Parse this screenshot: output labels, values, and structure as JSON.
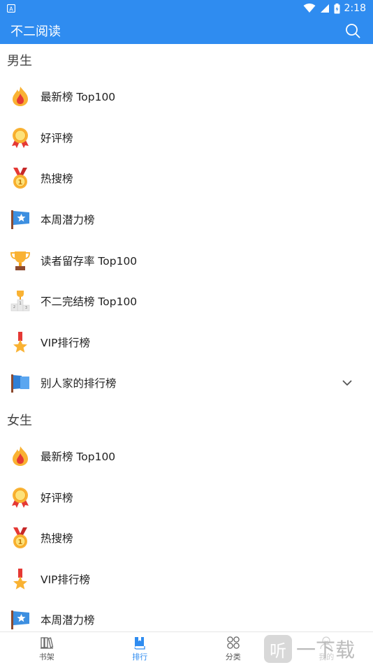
{
  "status": {
    "time": "2:18"
  },
  "app": {
    "title": "不二阅读"
  },
  "sections": [
    {
      "title": "男生",
      "items": [
        {
          "label": "最新榜 Top100",
          "icon": "flame-icon"
        },
        {
          "label": "好评榜",
          "icon": "award-rosette-icon"
        },
        {
          "label": "热搜榜",
          "icon": "gold-medal-icon"
        },
        {
          "label": "本周潜力榜",
          "icon": "star-flag-icon"
        },
        {
          "label": "读者留存率 Top100",
          "icon": "trophy-icon"
        },
        {
          "label": "不二完结榜 Top100",
          "icon": "podium-icon"
        },
        {
          "label": "VIP排行榜",
          "icon": "star-medal-icon"
        },
        {
          "label": "别人家的排行榜",
          "icon": "blue-flag-icon",
          "expandable": true
        }
      ]
    },
    {
      "title": "女生",
      "items": [
        {
          "label": "最新榜 Top100",
          "icon": "flame-icon"
        },
        {
          "label": "好评榜",
          "icon": "award-rosette-icon"
        },
        {
          "label": "热搜榜",
          "icon": "gold-medal-icon"
        },
        {
          "label": "VIP排行榜",
          "icon": "star-medal-icon"
        },
        {
          "label": "本周潜力榜",
          "icon": "star-flag-icon"
        }
      ]
    }
  ],
  "tabs": [
    {
      "label": "书架",
      "icon": "bookshelf-icon",
      "active": false
    },
    {
      "label": "排行",
      "icon": "book-icon",
      "active": true
    },
    {
      "label": "分类",
      "icon": "category-grid-icon",
      "active": false
    },
    {
      "label": "我的",
      "icon": "profile-icon",
      "active": false
    }
  ],
  "watermark": {
    "badge": "听",
    "text": "一下载"
  },
  "colors": {
    "primary": "#2f8cf0",
    "tab_active": "#2f8cf0"
  }
}
